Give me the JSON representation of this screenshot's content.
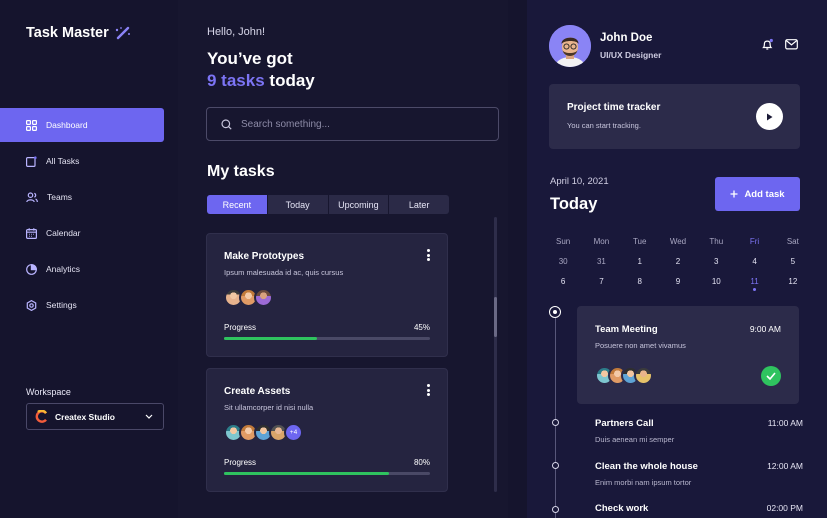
{
  "app": {
    "title": "Task Master"
  },
  "sidebar": {
    "items": [
      {
        "label": "Dashboard",
        "icon": "grid-icon",
        "active": true
      },
      {
        "label": "All Tasks",
        "icon": "tasks-icon",
        "active": false
      },
      {
        "label": "Teams",
        "icon": "users-icon",
        "active": false
      },
      {
        "label": "Calendar",
        "icon": "calendar-icon",
        "active": false
      },
      {
        "label": "Analytics",
        "icon": "pie-chart-icon",
        "active": false
      },
      {
        "label": "Settings",
        "icon": "gear-icon",
        "active": false
      }
    ],
    "workspace_label": "Workspace",
    "workspace_value": "Createx Studio"
  },
  "main": {
    "greeting": "Hello, John!",
    "headline_line1": "You’ve got",
    "headline_count": "9 tasks",
    "headline_suffix": "today",
    "search_placeholder": "Search something...",
    "section_title": "My tasks",
    "tabs": [
      {
        "label": "Recent",
        "active": true
      },
      {
        "label": "Today",
        "active": false
      },
      {
        "label": "Upcoming",
        "active": false
      },
      {
        "label": "Later",
        "active": false
      }
    ],
    "tasks": [
      {
        "title": "Make Prototypes",
        "subtitle": "Ipsum malesuada id ac, quis cursus",
        "progress_label": "Progress",
        "progress_text": "45%",
        "progress": 0.45,
        "extra_members": ""
      },
      {
        "title": "Create Assets",
        "subtitle": "Sit ullamcorper id nisi nulla",
        "progress_label": "Progress",
        "progress_text": "80%",
        "progress": 0.8,
        "extra_members": "+4"
      }
    ]
  },
  "right": {
    "user_name": "John Doe",
    "user_role": "UI/UX Designer",
    "tracker_title": "Project time tracker",
    "tracker_subtitle": "You can start tracking.",
    "date": "April 10, 2021",
    "today_label": "Today",
    "add_task_label": "Add task",
    "calendar": {
      "weekdays": [
        "Sun",
        "Mon",
        "Tue",
        "Wed",
        "Thu",
        "Fri",
        "Sat"
      ],
      "week1": [
        "30",
        "31",
        "1",
        "2",
        "3",
        "4",
        "5"
      ],
      "week2": [
        "6",
        "7",
        "8",
        "9",
        "10",
        "11",
        "12"
      ],
      "selected_day": "11"
    },
    "events": [
      {
        "title": "Team Meeting",
        "time": "9:00 AM",
        "subtitle": "Posuere non amet vivamus",
        "done": true
      },
      {
        "title": "Partners Call",
        "time": "11:00 AM",
        "subtitle": "Duis aenean mi semper"
      },
      {
        "title": "Clean the whole house",
        "time": "12:00 AM",
        "subtitle": "Enim morbi nam ipsum tortor"
      },
      {
        "title": "Check work",
        "time": "02:00 PM",
        "subtitle": ""
      }
    ]
  },
  "colors": {
    "accent": "#6d66f0",
    "accent_text": "#7c74f4",
    "background": "#15142d",
    "card": "#252440",
    "success": "#2fc35f"
  }
}
